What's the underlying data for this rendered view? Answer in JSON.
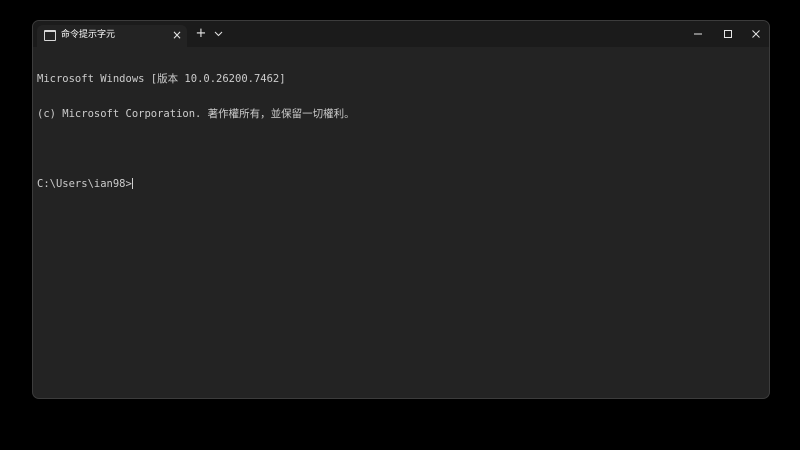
{
  "tab": {
    "title": "命令提示字元",
    "icon": "terminal-icon",
    "close_label": "×"
  },
  "toolbar": {
    "new_tab_label": "+",
    "dropdown_icon": "chevron-down-icon"
  },
  "window_controls": {
    "minimize_icon": "minimize-icon",
    "maximize_icon": "maximize-icon",
    "close_icon": "close-icon"
  },
  "console": {
    "lines": [
      "Microsoft Windows [版本 10.0.26200.7462]",
      "(c) Microsoft Corporation. 著作權所有，並保留一切權利。",
      ""
    ],
    "prompt": "C:\\Users\\ian98>"
  },
  "colors": {
    "background": "#000000",
    "window": "#232323",
    "titlebar": "#1b1b1b",
    "text": "#cccccc"
  }
}
